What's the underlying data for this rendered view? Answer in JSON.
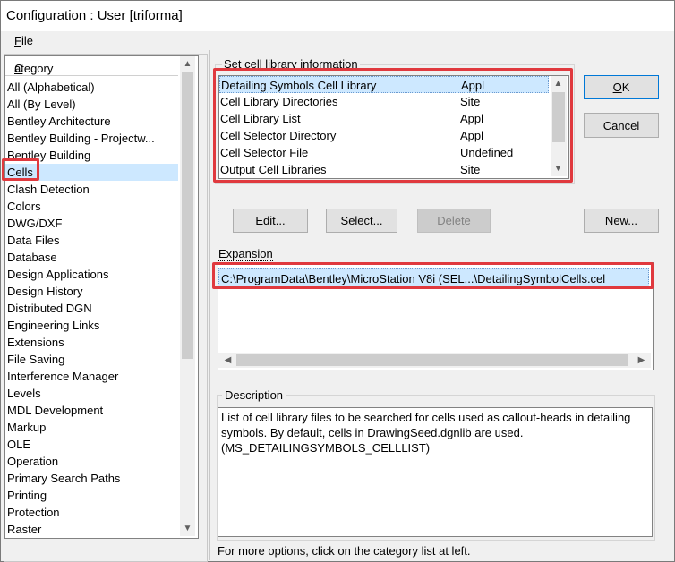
{
  "window": {
    "title": "Configuration : User [triforma]"
  },
  "menu": {
    "file_first": "F",
    "file_rest": "ile"
  },
  "category": {
    "header_first": "C",
    "header_rest": "ategory",
    "items": [
      "All (Alphabetical)",
      "All (By Level)",
      "Bentley Architecture",
      "Bentley Building - Projectw...",
      "Bentley Building",
      "Cells",
      "Clash Detection",
      "Colors",
      "DWG/DXF",
      "Data Files",
      "Database",
      "Design Applications",
      "Design History",
      "Distributed DGN",
      "Engineering Links",
      "Extensions",
      "File Saving",
      "Interference Manager",
      "Levels",
      "MDL Development",
      "Markup",
      "OLE",
      "Operation",
      "Primary Search Paths",
      "Printing",
      "Protection",
      "Raster"
    ],
    "selected": "Cells"
  },
  "library": {
    "label_pre": "",
    "label_ul": "S",
    "label_post": "et cell library information",
    "rows": [
      {
        "name": "Detailing Symbols Cell Library",
        "source": "Appl"
      },
      {
        "name": "Cell Library Directories",
        "source": "Site"
      },
      {
        "name": "Cell Library List",
        "source": "Appl"
      },
      {
        "name": "Cell Selector Directory",
        "source": "Appl"
      },
      {
        "name": "Cell Selector File",
        "source": "Undefined"
      },
      {
        "name": "Output Cell Libraries",
        "source": "Site"
      }
    ]
  },
  "buttons": {
    "ok_ul": "O",
    "ok_rest": "K",
    "cancel": "Cancel",
    "edit_ul": "E",
    "edit_rest": "dit...",
    "select_ul": "S",
    "select_rest": "elect...",
    "delete_ul": "D",
    "delete_rest": "elete",
    "new_ul": "N",
    "new_rest": "ew..."
  },
  "expansion": {
    "label": "Expansion",
    "value": "C:\\ProgramData\\Bentley\\MicroStation V8i (SEL...\\DetailingSymbolCells.cel"
  },
  "description": {
    "label": "Description",
    "text": "List of cell library files to be searched for cells used as callout-heads in detailing symbols. By default, cells in DrawingSeed.dgnlib are used. (MS_DETAILINGSYMBOLS_CELLLIST)"
  },
  "hint": "For more options, click on the category list at left.",
  "icons": {
    "up": "up-arrow-icon",
    "down": "down-arrow-icon",
    "left": "left-arrow-icon",
    "right": "right-arrow-icon"
  }
}
